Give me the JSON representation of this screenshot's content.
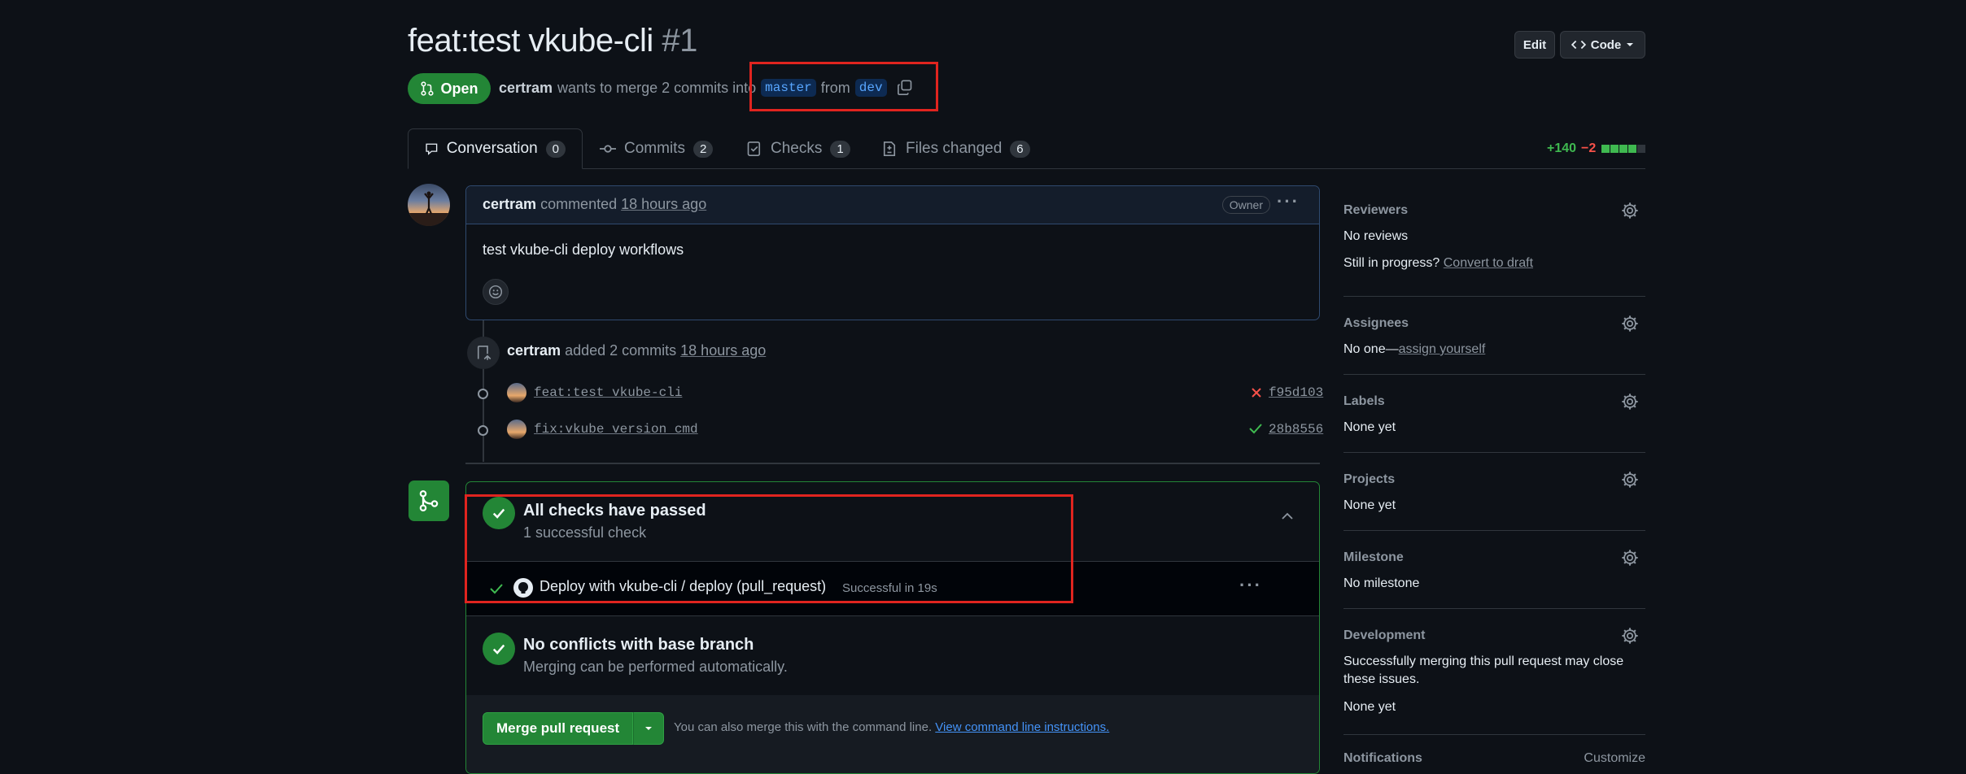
{
  "header": {
    "title": "feat:test vkube-cli",
    "number": "#1",
    "edit_label": "Edit",
    "code_label": "Code",
    "state": "Open",
    "author": "certram",
    "merge_text": "wants to merge 2 commits into",
    "base_branch": "master",
    "from_text": "from",
    "head_branch": "dev"
  },
  "tabs": [
    {
      "label": "Conversation",
      "count": "0"
    },
    {
      "label": "Commits",
      "count": "2"
    },
    {
      "label": "Checks",
      "count": "1"
    },
    {
      "label": "Files changed",
      "count": "6"
    }
  ],
  "diffstat": {
    "additions": "+140",
    "deletions": "−2"
  },
  "comment": {
    "author": "certram",
    "action": "commented",
    "time": "18 hours ago",
    "badge": "Owner",
    "body": "test vkube-cli deploy workflows"
  },
  "commits_event": {
    "author": "certram",
    "action": "added 2 commits",
    "time": "18 hours ago",
    "commits": [
      {
        "message": "feat:test vkube-cli",
        "sha": "f95d103",
        "status": "failure"
      },
      {
        "message": "fix:vkube version cmd",
        "sha": "28b8556",
        "status": "success"
      }
    ]
  },
  "merge_box": {
    "checks_title": "All checks have passed",
    "checks_sub": "1 successful check",
    "check_name": "Deploy with vkube-cli / deploy (pull_request)",
    "check_status": "Successful in 19s",
    "conflicts_title": "No conflicts with base branch",
    "conflicts_sub": "Merging can be performed automatically.",
    "merge_button": "Merge pull request",
    "cli_text": "You can also merge this with the command line.",
    "cli_link": "View command line instructions."
  },
  "sidebar": {
    "reviewers": {
      "title": "Reviewers",
      "value": "No reviews",
      "progress_q": "Still in progress?",
      "convert": "Convert to draft"
    },
    "assignees": {
      "title": "Assignees",
      "value_prefix": "No one—",
      "assign": "assign yourself"
    },
    "labels": {
      "title": "Labels",
      "value": "None yet"
    },
    "projects": {
      "title": "Projects",
      "value": "None yet"
    },
    "milestone": {
      "title": "Milestone",
      "value": "No milestone"
    },
    "development": {
      "title": "Development",
      "line1": "Successfully merging this pull request may close",
      "line2": "these issues.",
      "value": "None yet"
    },
    "notifications": {
      "title": "Notifications",
      "customize": "Customize"
    }
  },
  "colors": {
    "accent_green": "#238636",
    "link_blue": "#4493f8",
    "highlight_red": "#e0241f",
    "deletion_red": "#f85149"
  }
}
